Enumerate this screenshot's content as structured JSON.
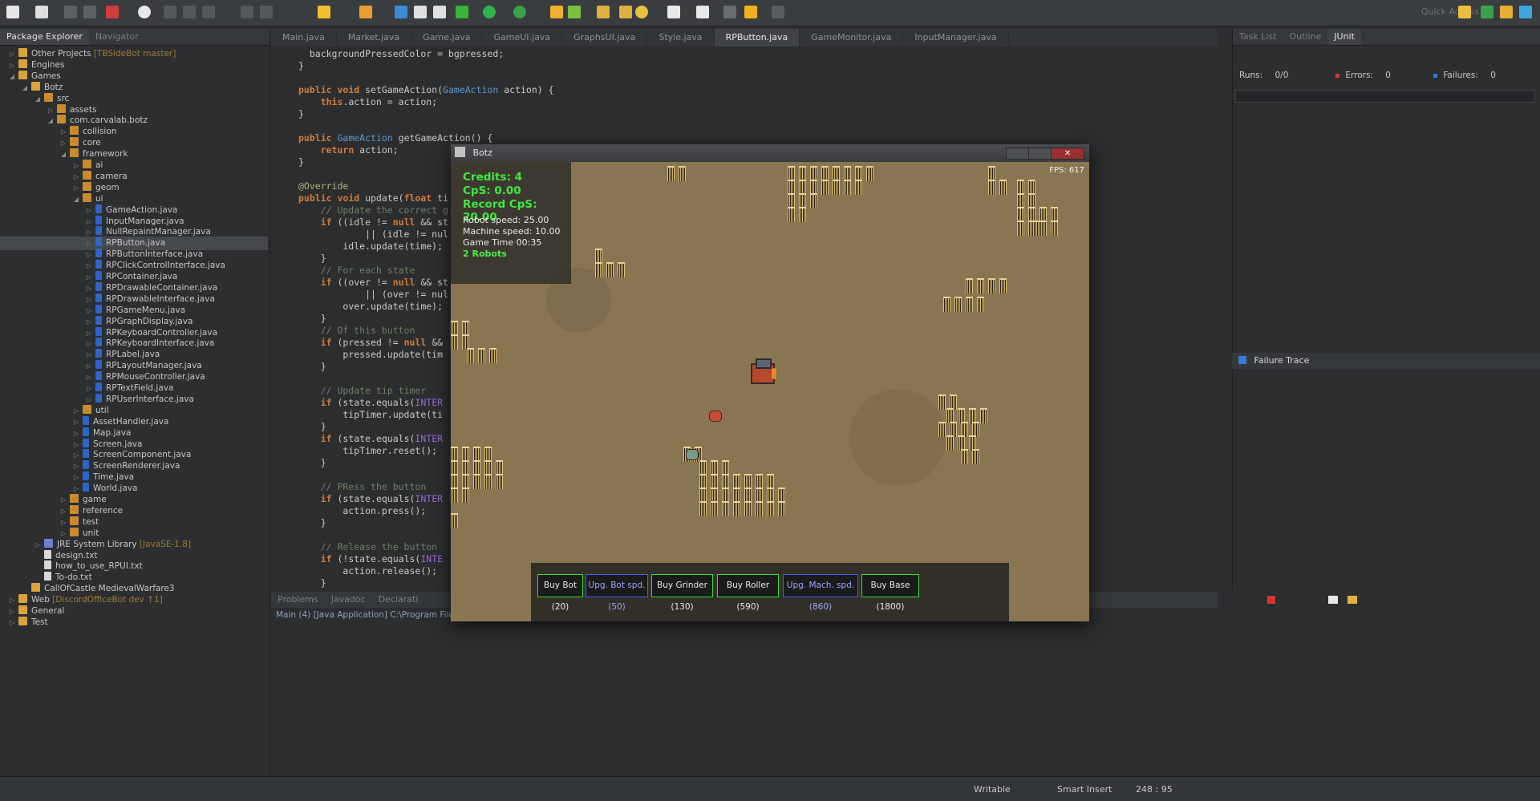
{
  "toolbar": {
    "quick_access": "Quick Access"
  },
  "left_pane": {
    "tabs": [
      {
        "label": "Package Explorer",
        "active": true
      },
      {
        "label": "Navigator",
        "active": false
      }
    ],
    "tree": [
      {
        "label": "Other Projects",
        "suffix": "[TBSideBot master]",
        "indent": 0,
        "icon": "project",
        "twisty": "▷"
      },
      {
        "label": "Engines",
        "indent": 0,
        "icon": "project",
        "twisty": "▷"
      },
      {
        "label": "Games",
        "indent": 0,
        "icon": "project",
        "twisty": "◢"
      },
      {
        "label": "Botz",
        "indent": 1,
        "icon": "project",
        "twisty": "◢"
      },
      {
        "label": "src",
        "indent": 2,
        "icon": "package",
        "twisty": "◢"
      },
      {
        "label": "assets",
        "indent": 3,
        "icon": "package",
        "twisty": "▷"
      },
      {
        "label": "com.carvalab.botz",
        "indent": 3,
        "icon": "package",
        "twisty": "◢"
      },
      {
        "label": "collision",
        "indent": 4,
        "icon": "package",
        "twisty": "▷"
      },
      {
        "label": "core",
        "indent": 4,
        "icon": "package",
        "twisty": "▷"
      },
      {
        "label": "framework",
        "indent": 4,
        "icon": "package",
        "twisty": "◢"
      },
      {
        "label": "ai",
        "indent": 5,
        "icon": "package",
        "twisty": "▷"
      },
      {
        "label": "camera",
        "indent": 5,
        "icon": "package",
        "twisty": "▷"
      },
      {
        "label": "geom",
        "indent": 5,
        "icon": "package",
        "twisty": "▷"
      },
      {
        "label": "ui",
        "indent": 5,
        "icon": "package",
        "twisty": "◢"
      },
      {
        "label": "GameAction.java",
        "indent": 6,
        "icon": "java",
        "twisty": "▷"
      },
      {
        "label": "InputManager.java",
        "indent": 6,
        "icon": "java",
        "twisty": "▷"
      },
      {
        "label": "NullRepaintManager.java",
        "indent": 6,
        "icon": "java",
        "twisty": "▷"
      },
      {
        "label": "RPButton.java",
        "indent": 6,
        "icon": "java",
        "twisty": "▷",
        "selected": true
      },
      {
        "label": "RPButtonInterface.java",
        "indent": 6,
        "icon": "java",
        "twisty": "▷"
      },
      {
        "label": "RPClickControlInterface.java",
        "indent": 6,
        "icon": "java",
        "twisty": "▷"
      },
      {
        "label": "RPContainer.java",
        "indent": 6,
        "icon": "java",
        "twisty": "▷"
      },
      {
        "label": "RPDrawableContainer.java",
        "indent": 6,
        "icon": "java",
        "twisty": "▷"
      },
      {
        "label": "RPDrawableInterface.java",
        "indent": 6,
        "icon": "java",
        "twisty": "▷"
      },
      {
        "label": "RPGameMenu.java",
        "indent": 6,
        "icon": "java",
        "twisty": "▷"
      },
      {
        "label": "RPGraphDisplay.java",
        "indent": 6,
        "icon": "java",
        "twisty": "▷"
      },
      {
        "label": "RPKeyboardController.java",
        "indent": 6,
        "icon": "java",
        "twisty": "▷"
      },
      {
        "label": "RPKeyboardInterface.java",
        "indent": 6,
        "icon": "java",
        "twisty": "▷"
      },
      {
        "label": "RPLabel.java",
        "indent": 6,
        "icon": "java",
        "twisty": "▷"
      },
      {
        "label": "RPLayoutManager.java",
        "indent": 6,
        "icon": "java",
        "twisty": "▷"
      },
      {
        "label": "RPMouseController.java",
        "indent": 6,
        "icon": "java",
        "twisty": "▷"
      },
      {
        "label": "RPTextField.java",
        "indent": 6,
        "icon": "java",
        "twisty": "▷"
      },
      {
        "label": "RPUserInterface.java",
        "indent": 6,
        "icon": "java",
        "twisty": "▷"
      },
      {
        "label": "util",
        "indent": 5,
        "icon": "package",
        "twisty": "▷"
      },
      {
        "label": "AssetHandler.java",
        "indent": 5,
        "icon": "java",
        "twisty": "▷"
      },
      {
        "label": "Map.java",
        "indent": 5,
        "icon": "java",
        "twisty": "▷"
      },
      {
        "label": "Screen.java",
        "indent": 5,
        "icon": "java",
        "twisty": "▷"
      },
      {
        "label": "ScreenComponent.java",
        "indent": 5,
        "icon": "java",
        "twisty": "▷"
      },
      {
        "label": "ScreenRenderer.java",
        "indent": 5,
        "icon": "java",
        "twisty": "▷"
      },
      {
        "label": "Time.java",
        "indent": 5,
        "icon": "java",
        "twisty": "▷"
      },
      {
        "label": "World.java",
        "indent": 5,
        "icon": "java",
        "twisty": "▷"
      },
      {
        "label": "game",
        "indent": 4,
        "icon": "package",
        "twisty": "▷"
      },
      {
        "label": "reference",
        "indent": 4,
        "icon": "package",
        "twisty": "▷"
      },
      {
        "label": "test",
        "indent": 4,
        "icon": "package",
        "twisty": "▷"
      },
      {
        "label": "unit",
        "indent": 4,
        "icon": "package",
        "twisty": "▷"
      },
      {
        "label": "JRE System Library",
        "suffix": "[JavaSE-1.8]",
        "indent": 2,
        "icon": "library",
        "twisty": "▷"
      },
      {
        "label": "design.txt",
        "indent": 2,
        "icon": "file",
        "twisty": ""
      },
      {
        "label": "how_to_use_RPUI.txt",
        "indent": 2,
        "icon": "file",
        "twisty": ""
      },
      {
        "label": "To-do.txt",
        "indent": 2,
        "icon": "file",
        "twisty": ""
      },
      {
        "label": "CallOfCastle MedievalWarfare3",
        "indent": 1,
        "icon": "project",
        "twisty": ""
      },
      {
        "label": "Web",
        "suffix": "[DiscordOfficeBot dev ↑1]",
        "indent": 0,
        "icon": "project",
        "twisty": "▷"
      },
      {
        "label": "General",
        "indent": 0,
        "icon": "project",
        "twisty": "▷"
      },
      {
        "label": "Test",
        "indent": 0,
        "icon": "project",
        "twisty": "▷"
      }
    ]
  },
  "editor": {
    "tabs": [
      {
        "label": "Main.java",
        "active": false
      },
      {
        "label": "Market.java",
        "active": false
      },
      {
        "label": "Game.java",
        "active": false
      },
      {
        "label": "GameUI.java",
        "active": false
      },
      {
        "label": "GraphsUI.java",
        "active": false
      },
      {
        "label": "Style.java",
        "active": false
      },
      {
        "label": "RPButton.java",
        "active": true
      },
      {
        "label": "GameMonitor.java",
        "active": false
      },
      {
        "label": "InputManager.java",
        "active": false
      }
    ],
    "lines": [
      "  backgroundPressedColor = bgpressed;",
      "}",
      "",
      "public void setGameAction(GameAction action) {",
      "    this.action = action;",
      "}",
      "",
      "public GameAction getGameAction() {",
      "    return action;",
      "}",
      "",
      "@Override",
      "public void update(float ti",
      "    // Update the correct g",
      "    if ((idle != null && st",
      "            || (idle != nul",
      "        idle.update(time);",
      "    }",
      "    // For each state",
      "    if ((over != null && st",
      "            || (over != nul",
      "        over.update(time);",
      "    }",
      "    // Of this button",
      "    if (pressed != null &&",
      "        pressed.update(tim",
      "    }",
      "",
      "    // Update tip timer",
      "    if (state.equals(INTER",
      "        tipTimer.update(ti",
      "    }",
      "    if (state.equals(INTER",
      "        tipTimer.reset();",
      "    }",
      "",
      "    // PRess the button",
      "    if (state.equals(INTER",
      "        action.press();",
      "    }",
      "",
      "    // Release the button",
      "    if (!state.equals(INTE",
      "        action.release();",
      "    }"
    ]
  },
  "console": {
    "tabs": [
      "Problems",
      "Javadoc",
      "Declarati"
    ],
    "launch_line": "Main (4) [Java Application] C:\\Program File"
  },
  "right_pane": {
    "tabs": [
      {
        "label": "Task List",
        "active": false
      },
      {
        "label": "Outline",
        "active": false
      },
      {
        "label": "JUnit",
        "active": true
      }
    ],
    "runs_label": "Runs:",
    "runs_value": "0/0",
    "errors_label": "Errors:",
    "errors_value": "0",
    "failures_label": "Failures:",
    "failures_value": "0",
    "failure_trace": "Failure Trace"
  },
  "statusbar": {
    "mode": "Writable",
    "insert": "Smart Insert",
    "position": "248 : 95"
  },
  "game": {
    "title": "Botz",
    "fps": "FPS: 617",
    "hud": {
      "credits": "Credits: 4",
      "cps": "CpS: 0.00",
      "record_cps": "Record CpS: 20.00",
      "robot_speed": "Robot speed: 25.00",
      "machine_speed": "Machine speed: 10.00",
      "game_time": "Game Time 00:35",
      "robots": "2 Robots"
    },
    "shop": [
      {
        "label": "Buy Bot (20)",
        "style": "green"
      },
      {
        "label": "Upg. Bot spd. (50)",
        "style": "blue"
      },
      {
        "label": "Buy Grinder (130)",
        "style": "green"
      },
      {
        "label": "Buy Roller (590)",
        "style": "green"
      },
      {
        "label": "Upg. Mach. spd. (860)",
        "style": "blue"
      },
      {
        "label": "Buy Base (1800)",
        "style": "green"
      }
    ]
  },
  "colors": {
    "accent_green": "#2ce02c",
    "accent_blue": "#4b5cf0",
    "ground": "#8a7552"
  }
}
